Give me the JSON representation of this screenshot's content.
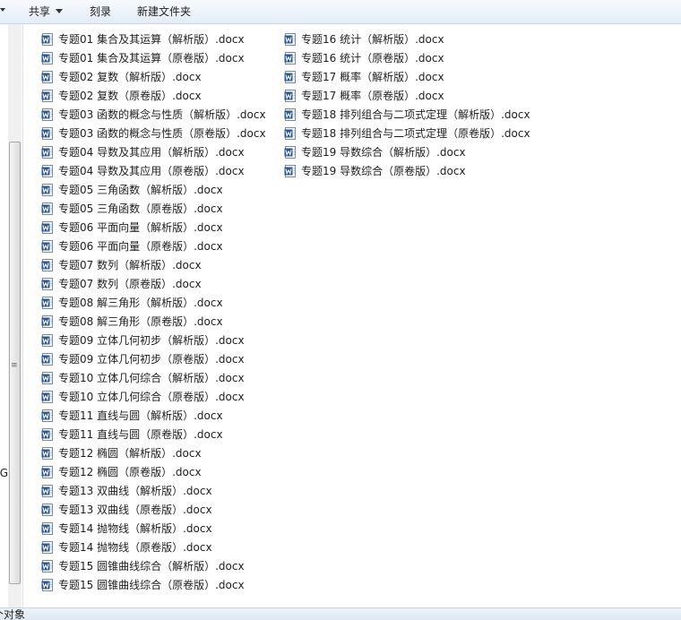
{
  "toolbar": {
    "share_label": "共享",
    "burn_label": "刻录",
    "new_folder_label": "新建文件夹"
  },
  "nav": {
    "clipped_text": "MPEG"
  },
  "status": {
    "clipped_text": "个对象"
  },
  "colors": {
    "word_icon_blue": "#2b5797",
    "toolbar_top": "#f7fafd",
    "toolbar_bottom": "#e4ecf6"
  },
  "icons": {
    "file_type": "word-document-icon"
  },
  "files": {
    "column1": [
      "专题01  集合及其运算（解析版）.docx",
      "专题01  集合及其运算（原卷版）.docx",
      "专题02 复数（解析版）.docx",
      "专题02 复数（原卷版）.docx",
      "专题03  函数的概念与性质（解析版）.docx",
      "专题03  函数的概念与性质（原卷版）.docx",
      "专题04  导数及其应用（解析版）.docx",
      "专题04  导数及其应用（原卷版）.docx",
      "专题05  三角函数（解析版）.docx",
      "专题05  三角函数（原卷版）.docx",
      "专题06  平面向量（解析版）.docx",
      "专题06  平面向量（原卷版）.docx",
      "专题07  数列（解析版）.docx",
      "专题07  数列（原卷版）.docx",
      "专题08  解三角形（解析版）.docx",
      "专题08  解三角形（原卷版）.docx",
      "专题09  立体几何初步（解析版）.docx",
      "专题09  立体几何初步（原卷版）.docx",
      "专题10  立体几何综合（解析版）.docx",
      "专题10 立体几何综合（原卷版）.docx",
      "专题11  直线与圆（解析版）.docx",
      "专题11  直线与圆（原卷版）.docx",
      "专题12 椭圆（解析版）.docx",
      "专题12 椭圆（原卷版）.docx",
      "专题13 双曲线（解析版）.docx",
      "专题13 双曲线（原卷版）.docx",
      "专题14 抛物线（解析版）.docx",
      "专题14 抛物线（原卷版）.docx",
      "专题15  圆锥曲线综合（解析版）.docx",
      "专题15  圆锥曲线综合（原卷版）.docx"
    ],
    "column2": [
      "专题16 统计（解析版）.docx",
      "专题16 统计（原卷版）.docx",
      "专题17  概率（解析版）.docx",
      "专题17  概率（原卷版）.docx",
      "专题18 排列组合与二项式定理（解析版）.docx",
      "专题18 排列组合与二项式定理（原卷版）.docx",
      "专题19 导数综合（解析版）.docx",
      "专题19 导数综合（原卷版）.docx"
    ]
  }
}
